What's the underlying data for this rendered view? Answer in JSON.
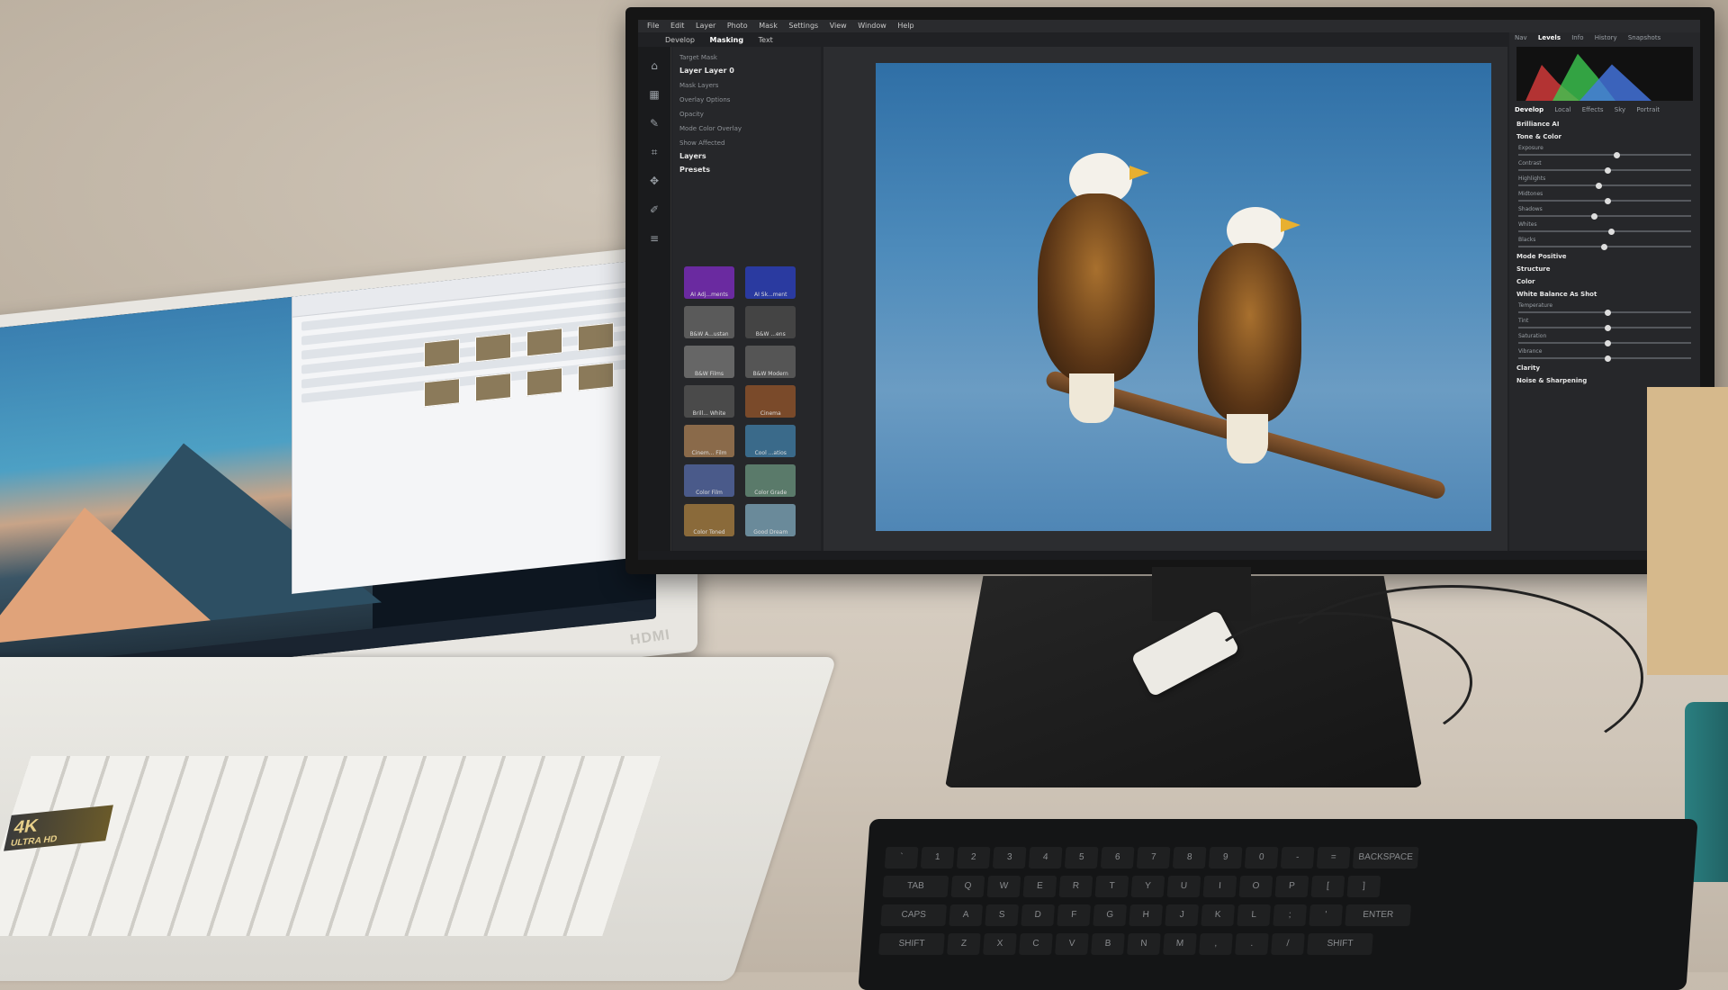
{
  "monitor_app": {
    "menu": [
      "File",
      "Edit",
      "Layer",
      "Photo",
      "Mask",
      "Settings",
      "View",
      "Window",
      "Help"
    ],
    "modes": [
      "Develop",
      "Masking",
      "Text"
    ],
    "active_mode": "Masking",
    "left_panel": {
      "target_mask": "Target Mask",
      "layer_name": "Layer Layer 0",
      "mask_layers": "Mask Layers",
      "overlay_options": "Overlay Options",
      "opacity_label": "Opacity",
      "mode_label": "Mode",
      "mode_value": "Color Overlay",
      "show_label": "Show",
      "show_value": "Affected",
      "layers_title": "Layers",
      "presets_title": "Presets",
      "presets": [
        "AI Adj...ments",
        "AI Sk...ment",
        "B&W A...ustan",
        "B&W ...ens",
        "B&W Films",
        "B&W Modern",
        "Brill... White",
        "Cinema",
        "Cinem... Film",
        "Cool ...atios",
        "Color Film",
        "Color Grade",
        "Color Toned",
        "Good Dream"
      ]
    },
    "right_panel": {
      "tabs": [
        "Nav",
        "Levels",
        "Info",
        "History",
        "Snapshots"
      ],
      "active_tab": "Levels",
      "develop_tabs": [
        "Develop",
        "Local",
        "Effects",
        "Sky",
        "Portrait"
      ],
      "brilliance": "Brilliance AI",
      "tone_color": "Tone & Color",
      "sliders": [
        "Exposure",
        "Contrast",
        "Highlights",
        "Midtones",
        "Shadows",
        "Whites",
        "Blacks"
      ],
      "mode_label": "Mode",
      "mode_value": "Positive",
      "structure": "Structure",
      "color": "Color",
      "white_balance": "White Balance",
      "wb_value": "As Shot",
      "temperature": "Temperature",
      "tint": "Tint",
      "saturation": "Saturation",
      "vibrance": "Vibrance",
      "clarity": "Clarity",
      "noise_sharpening": "Noise & Sharpening"
    }
  },
  "laptop": {
    "sticker_line1": "4K",
    "sticker_line2": "ULTRA HD",
    "hdmi_label": "HDMI"
  },
  "keyboard_keys": {
    "row1": [
      "`",
      "1",
      "2",
      "3",
      "4",
      "5",
      "6",
      "7",
      "8",
      "9",
      "0",
      "-",
      "=",
      "BACKSPACE"
    ],
    "row2": [
      "TAB",
      "Q",
      "W",
      "E",
      "R",
      "T",
      "Y",
      "U",
      "I",
      "O",
      "P",
      "[",
      "]"
    ],
    "row3": [
      "CAPS",
      "A",
      "S",
      "D",
      "F",
      "G",
      "H",
      "J",
      "K",
      "L",
      ";",
      "'",
      "ENTER"
    ],
    "row4": [
      "SHIFT",
      "Z",
      "X",
      "C",
      "V",
      "B",
      "N",
      "M",
      ",",
      ".",
      "/",
      "SHIFT"
    ]
  }
}
